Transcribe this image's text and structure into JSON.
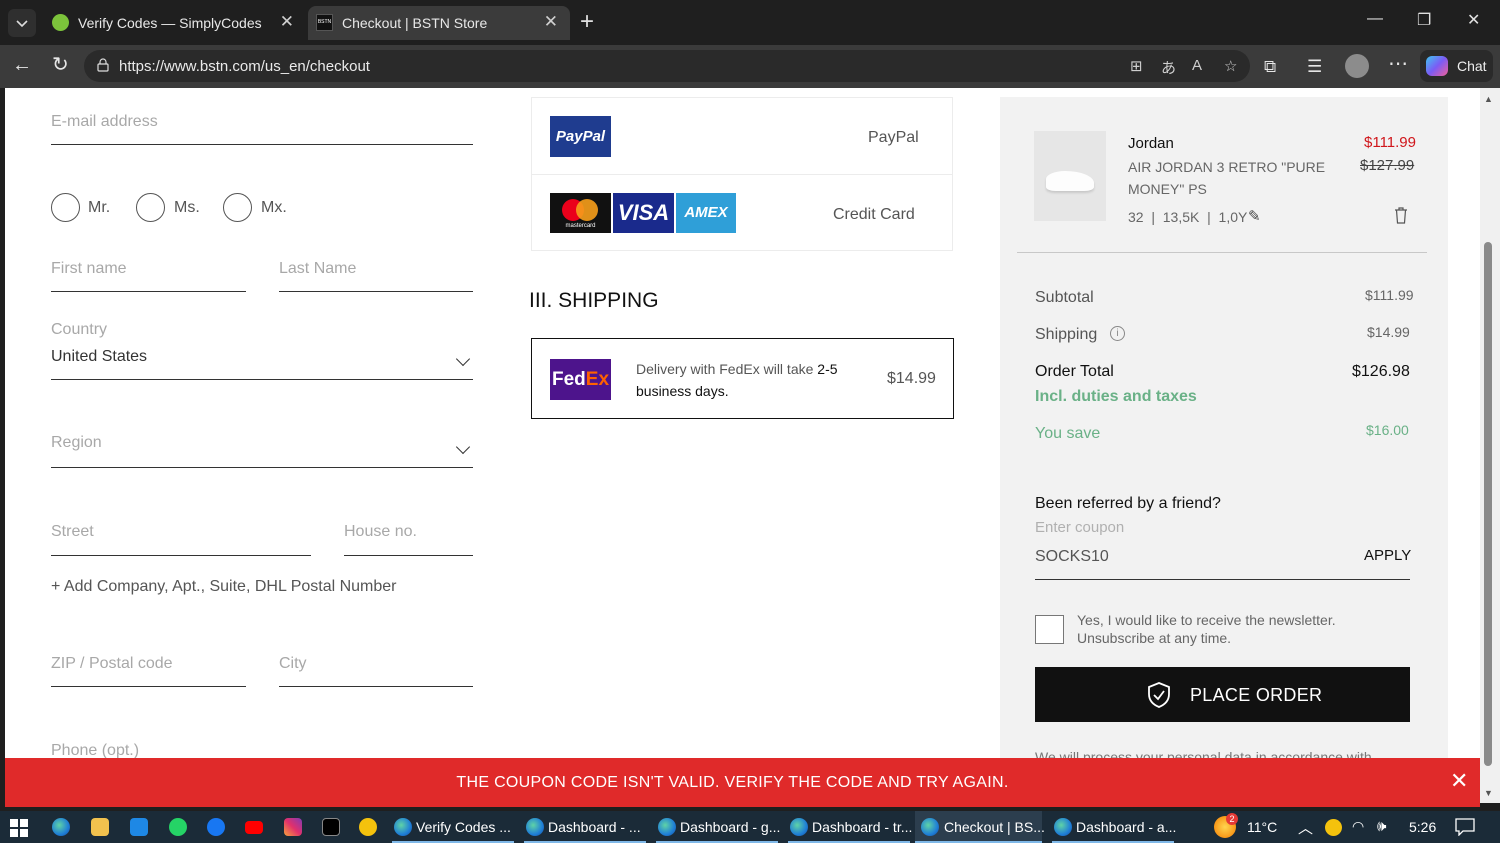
{
  "browser": {
    "tabs": [
      {
        "title": "Verify Codes — SimplyCodes",
        "active": false
      },
      {
        "title": "Checkout | BSTN Store",
        "active": true
      }
    ],
    "url": "https://www.bstn.com/us_en/checkout",
    "chat_label": "Chat"
  },
  "form": {
    "email_placeholder": "E-mail address",
    "salutations": [
      "Mr.",
      "Ms.",
      "Mx."
    ],
    "first_name_placeholder": "First name",
    "last_name_placeholder": "Last Name",
    "country_label": "Country",
    "country_value": "United States",
    "region_placeholder": "Region",
    "street_placeholder": "Street",
    "house_placeholder": "House no.",
    "add_company_link": "+ Add Company, Apt., Suite, DHL Postal Number",
    "zip_placeholder": "ZIP / Postal code",
    "city_placeholder": "City",
    "phone_placeholder": "Phone (opt.)"
  },
  "payment": {
    "options": [
      {
        "name": "PayPal",
        "logo": "PayPal"
      },
      {
        "name": "Credit Card",
        "logos": [
          "mastercard",
          "VISA",
          "AMEX"
        ]
      }
    ]
  },
  "shipping": {
    "heading": "III. SHIPPING",
    "carrier_logo": "FedEx",
    "description_prefix": "Delivery with FedEx will take",
    "description_bold": "2-5",
    "description_suffix": "business days.",
    "price": "$14.99"
  },
  "summary": {
    "product": {
      "brand": "Jordan",
      "name": "AIR JORDAN 3 RETRO \"PURE MONEY\" PS",
      "sizes": "32  |  13,5K  |  1,0Y",
      "price": "$111.99",
      "old_price": "$127.99"
    },
    "subtotal_label": "Subtotal",
    "subtotal_value": "$111.99",
    "shipping_label": "Shipping",
    "shipping_value": "$14.99",
    "total_label": "Order Total",
    "total_value": "$126.98",
    "taxes_note": "Incl. duties and taxes",
    "save_label": "You save",
    "save_value": "$16.00",
    "referral_heading": "Been referred by a friend?",
    "coupon_placeholder": "Enter coupon",
    "coupon_value": "SOCKS10",
    "apply_label": "APPLY",
    "newsletter_text": "Yes, I would like to receive the newsletter. Unsubscribe at any time.",
    "place_order_label": "PLACE ORDER",
    "privacy_partial": "We will process your personal data in accordance with"
  },
  "alert": {
    "message": "THE COUPON CODE ISN'T VALID. VERIFY THE CODE AND TRY AGAIN."
  },
  "taskbar": {
    "items": [
      {
        "label": "Verify Codes ...",
        "active": false
      },
      {
        "label": "Dashboard - ...",
        "active": false
      },
      {
        "label": "Dashboard - g...",
        "active": false
      },
      {
        "label": "Dashboard - tr...",
        "active": false
      },
      {
        "label": "Checkout | BS...",
        "active": true
      },
      {
        "label": "Dashboard - a...",
        "active": false
      }
    ],
    "weather": "11°C",
    "weather_badge": "2",
    "time": "5:26"
  },
  "colors": {
    "accent_green": "#6ab187",
    "price_red": "#d0161b",
    "alert_red": "#e02a2a",
    "button_black": "#111111"
  }
}
